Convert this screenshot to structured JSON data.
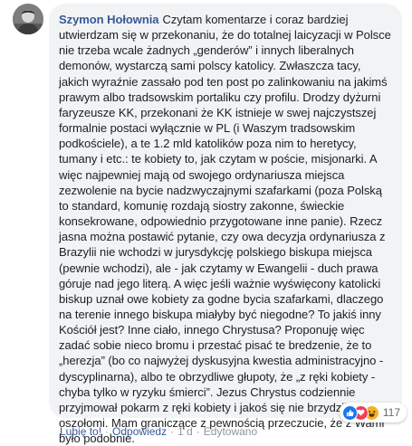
{
  "comment": {
    "author": "Szymon Hołownia",
    "text": "Czytam komentarze i coraz bardziej utwierdzam się w przekonaniu, że do totalnej laicyzacji w Polsce nie trzeba wcale żadnych „genderów” i innych liberalnych demonów, wystarczą sami polscy katolicy. Zwłaszcza tacy, jakich wyraźnie zassało pod ten post po zalinkowaniu na jakimś prawym albo tradsowskim portaliku czy profilu. Drodzy dyżurni faryzeusze KK, przekonani że KK istnieje w swej najczystszej formalnie postaci wyłącznie w PL (i Waszym tradsowskim podkościele), a te 1.2 mld katolików poza nim to heretycy, tumany i etc.: te kobiety to, jak czytam w poście, misjonarki. A więc najpewniej mają od swojego ordynariusza miejsca zezwolenie na bycie nadzwyczajnymi szafarkami (poza Polską to standard, komunię rozdają siostry zakonne, świeckie konsekrowane, odpowiednio przygotowane inne panie). Rzecz jasna można postawić pytanie, czy owa decyzja ordynariusza z Brazylii nie wchodzi w jurysdykcję polskiego biskupa miejsca (pewnie wchodzi), ale - jak czytamy w Ewangelii - duch prawa góruje nad jego literą. A więc jeśli ważnie wyświęcony katolicki biskup uznał owe kobiety za godne bycia szafarkami, dlaczego na terenie innego biskupa miałyby być niegodne? To jakiś inny Kościół jest? Inne ciało, innego Chrystusa? Proponuję więc zadać sobie nieco bromu i przestać pisać te bredzenie, że to „herezja” (bo co najwyżej dyskusyjna kwestia administracyjno - dyscyplinarna), albo te obrzydliwe głupoty, że „z ręki kobiety - chyba tylko w ryzyku śmierci”. Jezus Chrystus codziennie przyjmował pokarm z ręki kobiety i jakoś się nie brzydził, drodzy oszołomi. Mam graniczące z pewnością przeczucie, że z Wami było podobnie."
  },
  "reactions": {
    "icons": [
      "like-icon",
      "love-icon",
      "haha-icon"
    ],
    "count": "117"
  },
  "actions": {
    "like_label": "Lubię to!",
    "reply_label": "Odpowiedz",
    "separator": "·",
    "time": "1 d",
    "edited_label": "Edytowano"
  },
  "colors": {
    "author_link": "#385898",
    "bubble_bg": "#f2f3f5",
    "meta_text": "#90949c",
    "like_blue": "#1877f2",
    "love_red": "#f33e58",
    "haha_yellow": "#f7b125"
  }
}
